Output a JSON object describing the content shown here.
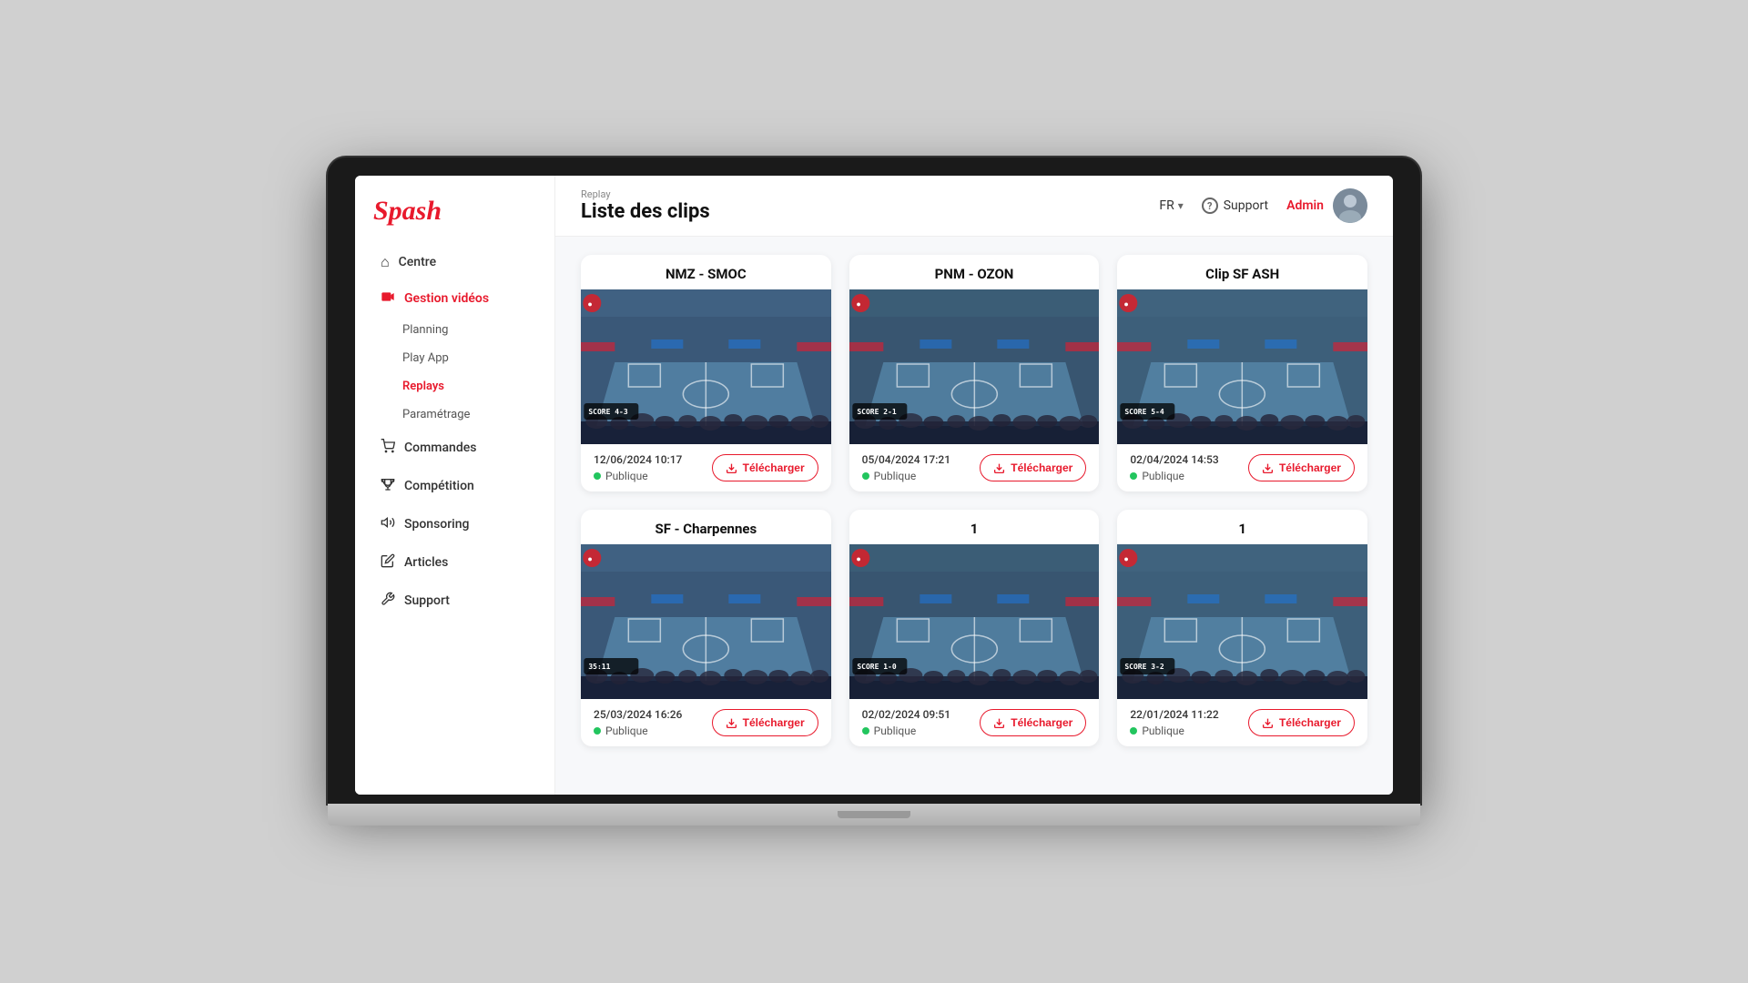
{
  "sidebar": {
    "logo": "Spash",
    "nav": [
      {
        "id": "centre",
        "label": "Centre",
        "icon": "🏠",
        "type": "item"
      },
      {
        "id": "gestion-videos",
        "label": "Gestion vidéos",
        "icon": "🎬",
        "type": "section-header",
        "active": true
      },
      {
        "id": "planning",
        "label": "Planning",
        "type": "subitem"
      },
      {
        "id": "play-app",
        "label": "Play App",
        "type": "subitem"
      },
      {
        "id": "replays",
        "label": "Replays",
        "type": "subitem",
        "active": true
      },
      {
        "id": "parametrage",
        "label": "Paramétrage",
        "type": "subitem"
      },
      {
        "id": "commandes",
        "label": "Commandes",
        "icon": "🛒",
        "type": "item"
      },
      {
        "id": "competition",
        "label": "Compétition",
        "icon": "🏆",
        "type": "item"
      },
      {
        "id": "sponsoring",
        "label": "Sponsoring",
        "icon": "📢",
        "type": "item"
      },
      {
        "id": "articles",
        "label": "Articles",
        "icon": "✏️",
        "type": "item"
      },
      {
        "id": "support",
        "label": "Support",
        "icon": "🔧",
        "type": "item"
      }
    ]
  },
  "header": {
    "breadcrumb": "Replay",
    "title": "Liste des clips",
    "lang": "FR",
    "support_label": "Support",
    "admin_label": "Admin"
  },
  "clips": [
    {
      "id": "clip-1",
      "title": "NMZ - SMOC",
      "date": "12/06/2024 10:17",
      "status": "Publique",
      "download_label": "Télécharger",
      "court_class": "court-1",
      "scoreboard": "SCORE 4-3"
    },
    {
      "id": "clip-2",
      "title": "PNM - OZON",
      "date": "05/04/2024 17:21",
      "status": "Publique",
      "download_label": "Télécharger",
      "court_class": "court-2",
      "scoreboard": "SCORE 2-1"
    },
    {
      "id": "clip-3",
      "title": "Clip SF ASH",
      "date": "02/04/2024 14:53",
      "status": "Publique",
      "download_label": "Télécharger",
      "court_class": "court-3",
      "scoreboard": "SCORE 5-4"
    },
    {
      "id": "clip-4",
      "title": "SF - Charpennes",
      "date": "25/03/2024 16:26",
      "status": "Publique",
      "download_label": "Télécharger",
      "court_class": "court-1",
      "scoreboard": "35:11"
    },
    {
      "id": "clip-5",
      "title": "1",
      "date": "02/02/2024 09:51",
      "status": "Publique",
      "download_label": "Télécharger",
      "court_class": "court-2",
      "scoreboard": "SCORE 1-0"
    },
    {
      "id": "clip-6",
      "title": "1",
      "date": "22/01/2024 11:22",
      "status": "Publique",
      "download_label": "Télécharger",
      "court_class": "court-3",
      "scoreboard": "SCORE 3-2"
    }
  ],
  "icons": {
    "download": "⬇",
    "chevron_down": "▾",
    "question": "?",
    "home": "⌂",
    "video": "▶",
    "cart": "🛒",
    "trophy": "🏆",
    "megaphone": "📢",
    "pen": "✏",
    "wrench": "🔧"
  },
  "colors": {
    "brand_red": "#e8192c",
    "status_green": "#22c55e",
    "sidebar_bg": "#ffffff",
    "content_bg": "#f7f8fa"
  }
}
